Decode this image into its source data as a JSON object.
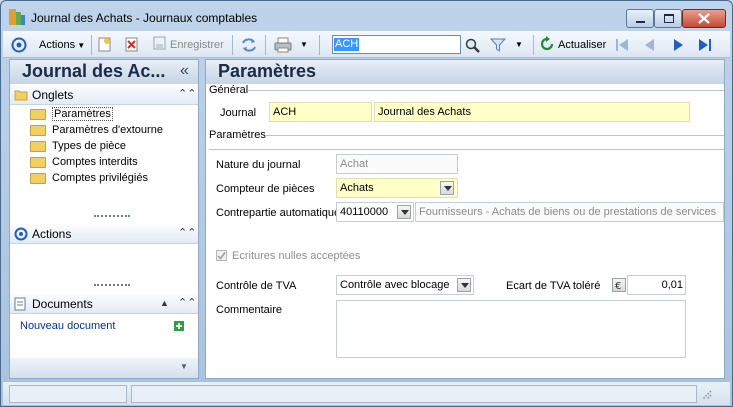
{
  "window": {
    "title": "Journal des Achats - Journaux comptables",
    "controls": {
      "minimize": "minimize",
      "maximize": "maximize",
      "close": "close"
    }
  },
  "toolbar": {
    "actions_label": "Actions",
    "save_label": "Enregistrer",
    "search_value": "ACH",
    "refresh_label": "Actualiser"
  },
  "left_panel": {
    "title": "Journal des Ac...",
    "collapse_glyph": "«",
    "onglets": {
      "header": "Onglets",
      "items": [
        {
          "label": "Paramètres",
          "selected": true
        },
        {
          "label": "Paramètres d'extourne",
          "selected": false
        },
        {
          "label": "Types de pièce",
          "selected": false
        },
        {
          "label": "Comptes interdits",
          "selected": false
        },
        {
          "label": "Comptes privilégiés",
          "selected": false
        }
      ]
    },
    "actions": {
      "header": "Actions"
    },
    "documents": {
      "header": "Documents",
      "new_document": "Nouveau document"
    }
  },
  "main": {
    "title": "Paramètres",
    "general": {
      "group_label": "Général",
      "journal_label": "Journal",
      "journal_code": "ACH",
      "journal_name": "Journal des Achats"
    },
    "parametres": {
      "group_label": "Paramètres",
      "nature_label": "Nature du journal",
      "nature_value": "Achat",
      "compteur_label": "Compteur de pièces",
      "compteur_value": "Achats",
      "contrepartie_label": "Contrepartie automatique",
      "contrepartie_account": "40110000",
      "contrepartie_desc": "Fournisseurs - Achats de biens ou de prestations de services",
      "ecritures_label": "Ecritures nulles acceptées",
      "ecritures_checked": true,
      "tva_label": "Contrôle de TVA",
      "tva_value": "Contrôle avec blocage",
      "ecart_label": "Ecart de TVA toléré",
      "ecart_value": "0,01",
      "commentaire_label": "Commentaire",
      "commentaire_value": ""
    }
  },
  "colors": {
    "accent": "#1f5fbf",
    "required_field": "#ffffc8",
    "header_text": "#1b2b44",
    "link": "#003399"
  }
}
